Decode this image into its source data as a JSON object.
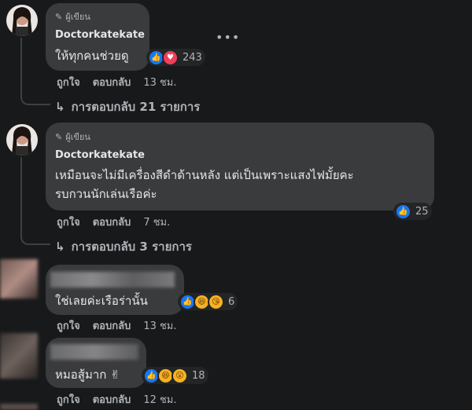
{
  "comments": [
    {
      "badge": "ผู้เขียน",
      "name": "Doctorkatekate",
      "text": "ให้ทุกคนช่วยดู",
      "reaction_count": "243",
      "like": "ถูกใจ",
      "reply": "ตอบกลับ",
      "time": "13 ชม.",
      "replies": "การตอบกลับ 21 รายการ"
    },
    {
      "badge": "ผู้เขียน",
      "name": "Doctorkatekate",
      "text_line1": "เหมือนจะไม่มีเครื่องสีดำด้านหลัง แต่เป็นเพราะแสงไฟมั้ยคะ",
      "text_line2": "รบกวนนักเล่นเรือค่ะ",
      "reaction_count": "25",
      "like": "ถูกใจ",
      "reply": "ตอบกลับ",
      "time": "7 ชม.",
      "replies": "การตอบกลับ 3 รายการ"
    },
    {
      "text": "ใช่เลยค่ะเรือร่านั้น",
      "reaction_count": "6",
      "like": "ถูกใจ",
      "reply": "ตอบกลับ",
      "time": "13 ชม."
    },
    {
      "text": "หมอสู้มาก ✌",
      "reaction_count": "18",
      "like": "ถูกใจ",
      "reply": "ตอบกลับ",
      "time": "12 ชม."
    }
  ],
  "colors": {
    "like": "#1877f2",
    "love": "#f33e58",
    "haha": "#f7b125",
    "bubble": "#3a3b3c"
  }
}
